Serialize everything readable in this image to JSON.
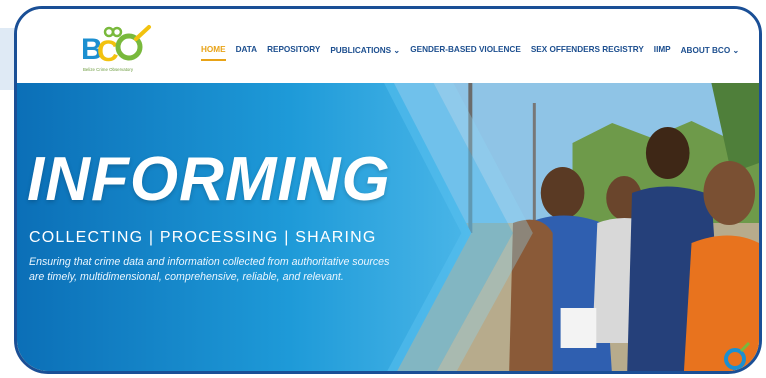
{
  "site": {
    "logo_tagline": "Belize Crime Observatory"
  },
  "nav": [
    {
      "label": "HOME",
      "active": true
    },
    {
      "label": "DATA",
      "active": false
    },
    {
      "label": "REPOSITORY",
      "active": false
    },
    {
      "label": "PUBLICATIONS ⌄",
      "active": false
    },
    {
      "label": "GENDER-BASED VIOLENCE",
      "active": false
    },
    {
      "label": "SEX OFFENDERS REGISTRY",
      "active": false
    },
    {
      "label": "IIMP",
      "active": false
    },
    {
      "label": "ABOUT BCO ⌄",
      "active": false
    }
  ],
  "hero": {
    "headline": "INFORMING",
    "subhead": "COLLECTING | PROCESSING | SHARING",
    "description": "Ensuring that crime data and information collected from authoritative sources are timely, multidimensional, comprehensive, reliable, and relevant."
  },
  "colors": {
    "frame": "#1a4f96",
    "nav_text": "#1d4f8f",
    "nav_active": "#e8a317",
    "hero_blue": "#1e9ad8"
  }
}
